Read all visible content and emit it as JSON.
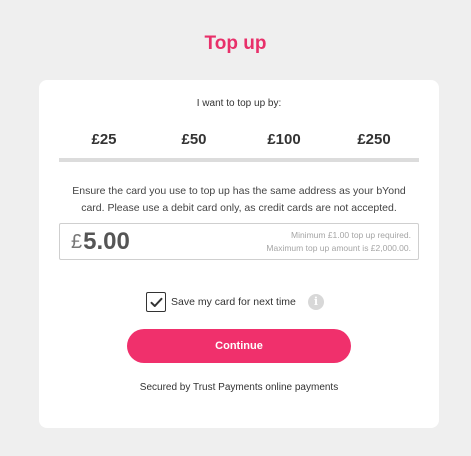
{
  "title": "Top up",
  "prompt": "I want to top up by:",
  "amount_options": [
    {
      "label": "£25"
    },
    {
      "label": "£50"
    },
    {
      "label": "£100"
    },
    {
      "label": "£250"
    }
  ],
  "notice_line1": "Ensure the card you use to top up has the same address as your bYond",
  "notice_line2": "card. Please use a debit card only, as credit cards are not accepted.",
  "amount_input": {
    "currency": "£",
    "value": "5.00",
    "min_note": "Minimum £1.00 top up required.",
    "max_note": "Maximum top up amount is £2,000.00."
  },
  "save_card": {
    "label": "Save my card for next time",
    "checked": true,
    "info_icon": "info-icon"
  },
  "continue_label": "Continue",
  "secure_note": "Secured by Trust Payments online payments",
  "colors": {
    "accent": "#f0306c",
    "title": "#e8306a",
    "background": "#efefef"
  }
}
